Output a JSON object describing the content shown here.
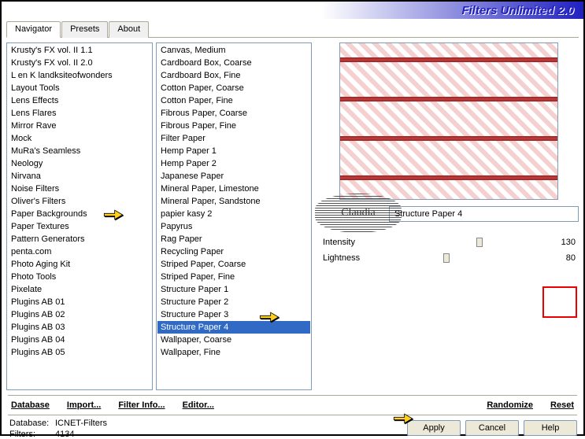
{
  "header": {
    "title": "Filters Unlimited 2.0"
  },
  "tabs": [
    {
      "label": "Navigator",
      "active": true
    },
    {
      "label": "Presets",
      "active": false
    },
    {
      "label": "About",
      "active": false
    }
  ],
  "categories": [
    "Krusty's FX vol. II 1.1",
    "Krusty's FX vol. II 2.0",
    "L en K landksiteofwonders",
    "Layout Tools",
    "Lens Effects",
    "Lens Flares",
    "Mirror Rave",
    "Mock",
    "MuRa's Seamless",
    "Neology",
    "Nirvana",
    "Noise Filters",
    "Oliver's Filters",
    "Paper Backgrounds",
    "Paper Textures",
    "Pattern Generators",
    "penta.com",
    "Photo Aging Kit",
    "Photo Tools",
    "Pixelate",
    "Plugins AB 01",
    "Plugins AB 02",
    "Plugins AB 03",
    "Plugins AB 04",
    "Plugins AB 05"
  ],
  "category_selected": "Paper Textures",
  "filters": [
    "Canvas, Medium",
    "Cardboard Box, Coarse",
    "Cardboard Box, Fine",
    "Cotton Paper, Coarse",
    "Cotton Paper, Fine",
    "Fibrous Paper, Coarse",
    "Fibrous Paper, Fine",
    "Filter Paper",
    "Hemp Paper 1",
    "Hemp Paper 2",
    "Japanese Paper",
    "Mineral Paper, Limestone",
    "Mineral Paper, Sandstone",
    "papier kasy 2",
    "Papyrus",
    "Rag Paper",
    "Recycling Paper",
    "Striped Paper, Coarse",
    "Striped Paper, Fine",
    "Structure Paper 1",
    "Structure Paper 2",
    "Structure Paper 3",
    "Structure Paper 4",
    "Wallpaper, Coarse",
    "Wallpaper, Fine"
  ],
  "filter_selected": "Structure Paper 4",
  "selected_filter_name": "Structure Paper 4",
  "params": [
    {
      "label": "Intensity",
      "value": 130
    },
    {
      "label": "Lightness",
      "value": 80
    }
  ],
  "bottom_links": {
    "database": "Database",
    "import": "Import...",
    "filter_info": "Filter Info...",
    "editor": "Editor...",
    "randomize": "Randomize",
    "reset": "Reset"
  },
  "status": {
    "db_label": "Database:",
    "db_value": "ICNET-Filters",
    "filters_label": "Filters:",
    "filters_value": "4134"
  },
  "buttons": {
    "apply": "Apply",
    "cancel": "Cancel",
    "help": "Help"
  },
  "watermark": "Claudia"
}
